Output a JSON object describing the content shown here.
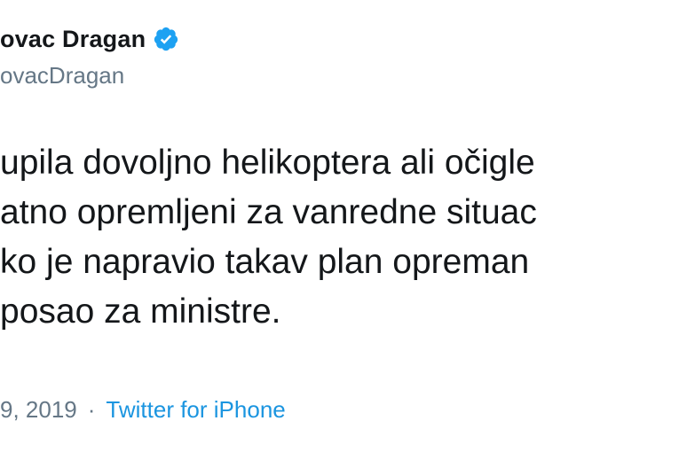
{
  "tweet": {
    "display_name": "ovac Dragan",
    "verified_icon": "verified-badge-icon",
    "handle": "ovacDragan",
    "text_lines": [
      "upila dovoljno helikoptera ali očigle",
      "atno opremljeni za vanredne situac",
      "ko je napravio takav plan opreman",
      "posao za ministre."
    ],
    "date": "9, 2019",
    "separator": "·",
    "source": "Twitter for iPhone"
  },
  "colors": {
    "text": "#14171a",
    "secondary": "#657786",
    "link": "#1b95e0",
    "verified": "#1da1f2"
  }
}
